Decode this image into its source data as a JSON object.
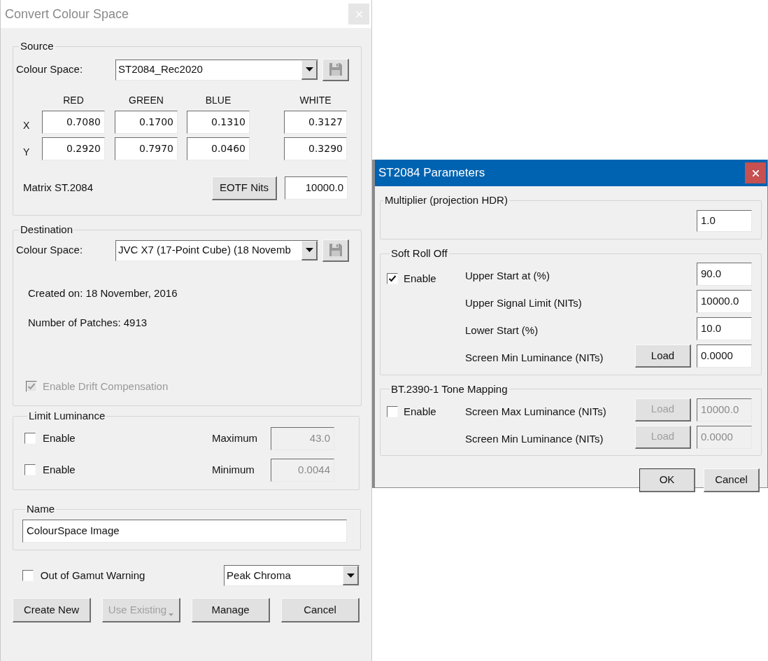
{
  "main_window": {
    "title": "Convert Colour Space",
    "source": {
      "title": "Source",
      "colour_space_label": "Colour Space:",
      "colour_space_value": "ST2084_Rec2020",
      "columns": [
        "RED",
        "GREEN",
        "BLUE",
        "WHITE"
      ],
      "rows": [
        {
          "label": "X",
          "values": [
            "0.7080",
            "0.1700",
            "0.1310",
            "0.3127"
          ]
        },
        {
          "label": "Y",
          "values": [
            "0.2920",
            "0.7970",
            "0.0460",
            "0.3290"
          ]
        }
      ],
      "matrix_label": "Matrix ST.2084",
      "eotf_button": "EOTF Nits",
      "eotf_value": "10000.0"
    },
    "destination": {
      "title": "Destination",
      "colour_space_label": "Colour Space:",
      "colour_space_value": "JVC X7 (17-Point Cube) (18 Novemb",
      "created_on": "Created on: 18 November, 2016",
      "patches": "Number of Patches: 4913",
      "drift": {
        "label": "Enable Drift Compensation",
        "checked": true,
        "disabled": true
      }
    },
    "limit_luminance": {
      "title": "Limit Luminance",
      "rows": [
        {
          "label": "Enable",
          "checked": false,
          "field_label": "Maximum",
          "value": "43.0",
          "disabled": true
        },
        {
          "label": "Enable",
          "checked": false,
          "field_label": "Minimum",
          "value": "0.0044",
          "disabled": true
        }
      ]
    },
    "name": {
      "title": "Name",
      "value": "ColourSpace Image"
    },
    "gamut": {
      "label": "Out of Gamut Warning",
      "checked": false,
      "mode": "Peak Chroma"
    },
    "buttons": [
      {
        "label": "Create New",
        "disabled": false,
        "kind": "plain"
      },
      {
        "label": "Use Existing",
        "disabled": true,
        "kind": "split"
      },
      {
        "label": "Manage",
        "disabled": false,
        "kind": "plain"
      },
      {
        "label": "Cancel",
        "disabled": false,
        "kind": "plain"
      }
    ]
  },
  "params_window": {
    "title": "ST2084 Parameters",
    "multiplier": {
      "title": "Multiplier (projection HDR)",
      "value": "1.0"
    },
    "groups": [
      {
        "title": "Soft Roll Off",
        "enable": {
          "label": "Enable",
          "checked": true
        },
        "rows": [
          {
            "label": "Upper Start at (%)",
            "value": "90.0",
            "disabled": false
          },
          {
            "label": "Upper Signal Limit (NITs)",
            "value": "10000.0",
            "disabled": false
          },
          {
            "label": "Lower Start (%)",
            "value": "10.0",
            "disabled": false
          },
          {
            "label": "Screen Min Luminance (NITs)",
            "button": "Load",
            "value": "0.0000",
            "disabled": false
          }
        ]
      },
      {
        "title": "BT.2390-1 Tone Mapping",
        "enable": {
          "label": "Enable",
          "checked": false
        },
        "rows": [
          {
            "label": "Screen Max Luminance (NITs)",
            "button": "Load",
            "value": "10000.0",
            "disabled": true
          },
          {
            "label": "Screen Min Luminance (NITs)",
            "button": "Load",
            "value": "0.0000",
            "disabled": true
          }
        ]
      }
    ],
    "buttons": [
      "OK",
      "Cancel"
    ]
  }
}
